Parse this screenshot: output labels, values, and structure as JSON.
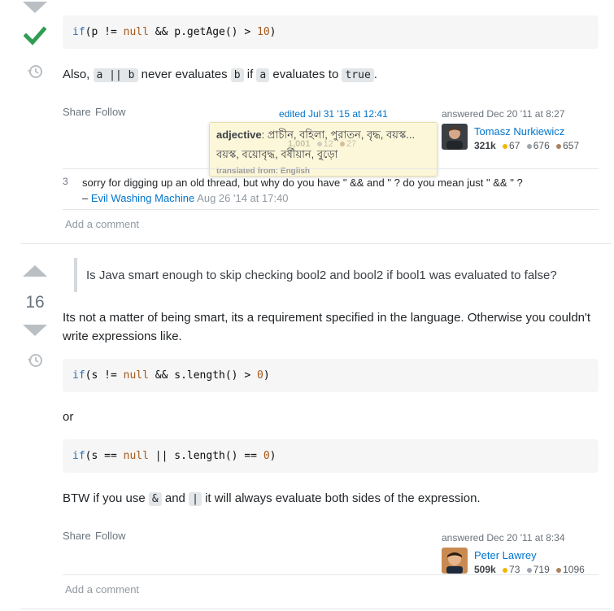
{
  "answer1": {
    "code_line": {
      "kw1": "if",
      "t1": "(p != ",
      "kw2": "null",
      "t2": " && p.getAge() > ",
      "num": "10",
      "t3": ")"
    },
    "para": {
      "t1": "Also,",
      "c1": "a || b",
      "t2": "never evaluates",
      "c2": "b",
      "t3": "if",
      "c3": "a",
      "t4": "evaluates to",
      "c4": "true",
      "t5": "."
    },
    "share_label": "Share",
    "follow_label": "Follow",
    "edited_label": "edited Jul 31 '15 at 12:41",
    "answered_label": "answered Dec 20 '11 at 8:27",
    "user": {
      "name": "Tomasz Nurkiewicz",
      "rep": "321k",
      "gold": "67",
      "silver": "676",
      "bronze": "657"
    },
    "comment": {
      "score": "3",
      "text": "sorry for digging up an old thread, but why do you have \" && and \" ? do you mean just \" && \" ?",
      "dash": "–",
      "user": "Evil Washing Machine",
      "date": "Aug 26 '14 at 17:40"
    },
    "add_comment": "Add a comment"
  },
  "tooltip": {
    "pos": "adjective",
    "line1": ": প্রাচীন, বহিলা, পুরাতন, বৃদ্ধ, বয়স্ক...",
    "line2": "বয়স্ক, বয়োবৃদ্ধ, বর্ষীয়ান, বুড়ো",
    "footer": "translated from: English",
    "ghost_rep": "1,001",
    "ghost_s": "12",
    "ghost_b": "27"
  },
  "answer2": {
    "score": "16",
    "quote": "Is Java smart enough to skip checking bool2 and bool2 if bool1 was evaluated to false?",
    "para1": "Its not a matter of being smart, its a requirement specified in the language. Otherwise you couldn't write expressions like.",
    "code1": {
      "kw1": "if",
      "t1": "(s != ",
      "kw2": "null",
      "t2": " && s.length() > ",
      "num": "0",
      "t3": ")"
    },
    "or_text": "or",
    "code2": {
      "kw1": "if",
      "t1": "(s == ",
      "kw2": "null",
      "t2": " || s.length() == ",
      "num": "0",
      "t3": ")"
    },
    "para2": {
      "t1": "BTW if you use",
      "c1": "&",
      "t2": "and",
      "c2": "|",
      "t3": "it will always evaluate both sides of the expression."
    },
    "share_label": "Share",
    "follow_label": "Follow",
    "answered_label": "answered Dec 20 '11 at 8:34",
    "user": {
      "name": "Peter Lawrey",
      "rep": "509k",
      "gold": "73",
      "silver": "719",
      "bronze": "1096"
    },
    "add_comment": "Add a comment"
  },
  "colors": {
    "accepted": "#2f9e52",
    "link": "#0074cc",
    "vote_arrow": "#babfc4"
  }
}
